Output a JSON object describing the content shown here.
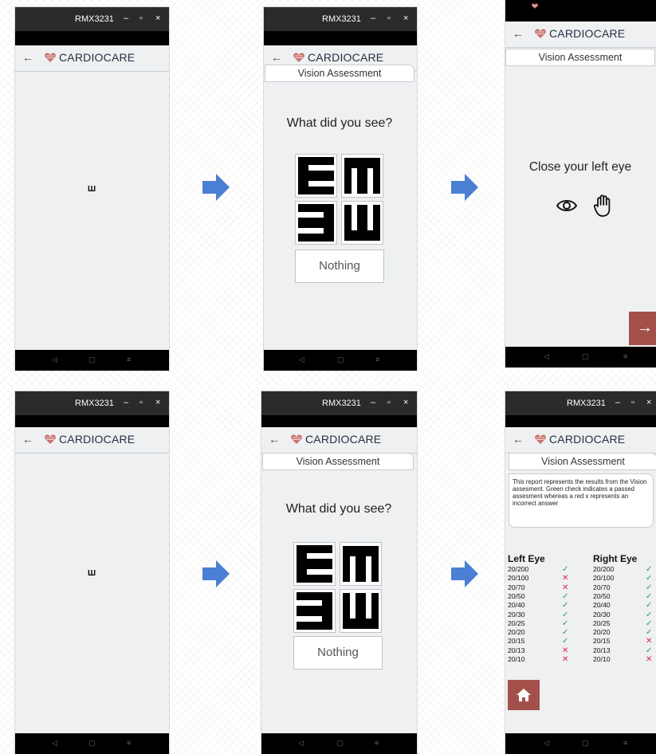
{
  "window_title": "RMX3231",
  "window_controls": {
    "minimize": "–",
    "maximize": "▫",
    "close": "×"
  },
  "app": {
    "back": "←",
    "brand": "CARDIOCARE"
  },
  "section_title": "Vision Assessment",
  "test_letter": "Ш",
  "question": "What did you see?",
  "choice_icons": [
    "e-right-icon",
    "e-down-icon",
    "e-left-icon",
    "e-up-icon"
  ],
  "nothing_label": "Nothing",
  "instruction": "Close your left eye",
  "next_glyph": "→",
  "nav_glyphs": [
    "◁",
    "▢",
    "≡"
  ],
  "report_text": "This report represents the results from the Vision assesment. Green check indicates a passed assesment whereas a red x represents an incorrect answer",
  "left_eye_label": "Left Eye",
  "right_eye_label": "Right Eye",
  "left_eye": [
    {
      "acuity": "20/200",
      "passed": true
    },
    {
      "acuity": "20/100",
      "passed": false
    },
    {
      "acuity": "20/70",
      "passed": false
    },
    {
      "acuity": "20/50",
      "passed": true
    },
    {
      "acuity": "20/40",
      "passed": true
    },
    {
      "acuity": "20/30",
      "passed": true
    },
    {
      "acuity": "20/25",
      "passed": true
    },
    {
      "acuity": "20/20",
      "passed": true
    },
    {
      "acuity": "20/15",
      "passed": true
    },
    {
      "acuity": "20/13",
      "passed": false
    },
    {
      "acuity": "20/10",
      "passed": false
    }
  ],
  "right_eye": [
    {
      "acuity": "20/200",
      "passed": true
    },
    {
      "acuity": "20/100",
      "passed": true
    },
    {
      "acuity": "20/70",
      "passed": true
    },
    {
      "acuity": "20/50",
      "passed": true
    },
    {
      "acuity": "20/40",
      "passed": true
    },
    {
      "acuity": "20/30",
      "passed": true
    },
    {
      "acuity": "20/25",
      "passed": true
    },
    {
      "acuity": "20/20",
      "passed": true
    },
    {
      "acuity": "20/15",
      "passed": false
    },
    {
      "acuity": "20/13",
      "passed": true
    },
    {
      "acuity": "20/10",
      "passed": false
    }
  ],
  "marks": {
    "pass": "✓",
    "fail": "✕"
  },
  "colors": {
    "accent_button": "#a4504a",
    "pass": "#2e9e4d",
    "fail": "#e0244a",
    "flow_arrow": "#4a7fd4"
  }
}
